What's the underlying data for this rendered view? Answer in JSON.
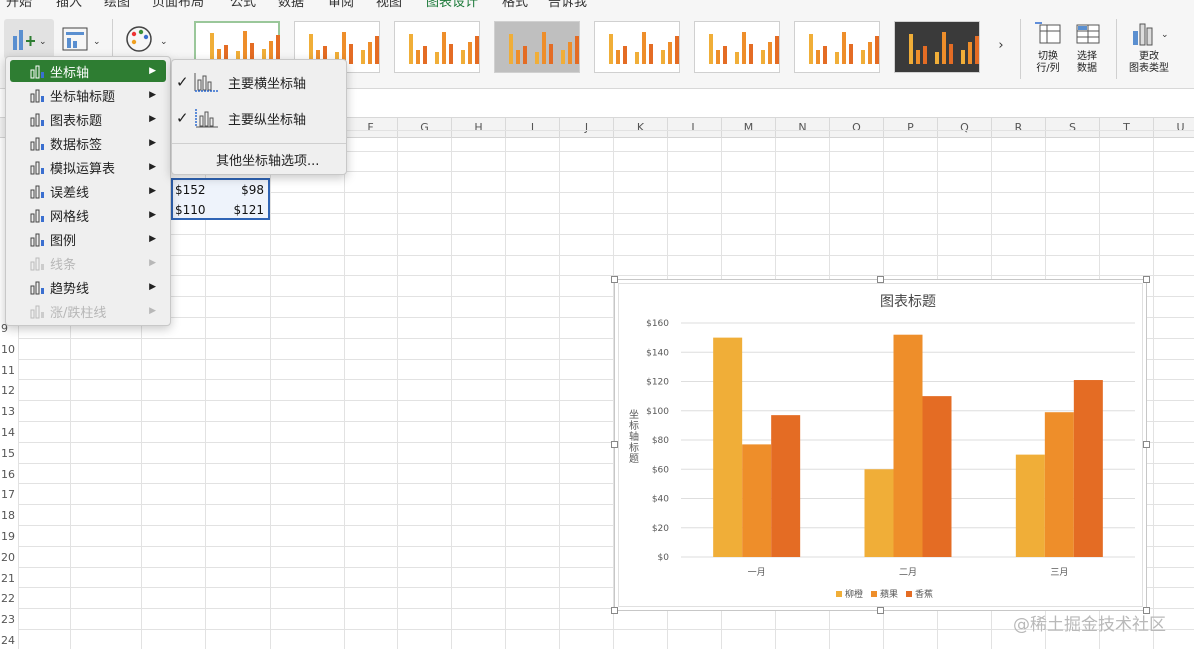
{
  "ribbon": {
    "tabs": [
      "开始",
      "插入",
      "绘图",
      "页面布局",
      "公式",
      "数据",
      "审阅",
      "视图",
      "图表设计",
      "格式",
      "告诉我"
    ],
    "active_tab": "图表设计",
    "switch_row_col": [
      "切换",
      "行/列"
    ],
    "select_data": [
      "选择",
      "数据"
    ],
    "change_chart_type": [
      "更改",
      "图表类型"
    ],
    "more_styles_icon": "chevron-right-icon",
    "accent": "#1d7a3a"
  },
  "columns": [
    "F",
    "G",
    "H",
    "I",
    "J",
    "K",
    "L",
    "M",
    "N",
    "O",
    "P",
    "Q",
    "R",
    "S",
    "T",
    "U"
  ],
  "rows": [
    "9",
    "10",
    "11",
    "12",
    "13",
    "14",
    "15",
    "16",
    "17",
    "18",
    "19",
    "20",
    "21",
    "22",
    "23",
    "24"
  ],
  "cells": {
    "r1": [
      "$152",
      "$98"
    ],
    "r2": [
      "$110",
      "$121"
    ]
  },
  "add_element_menu": {
    "items": [
      {
        "label": "坐标轴",
        "icon": "axis-icon",
        "highlighted": true,
        "disabled": false
      },
      {
        "label": "坐标轴标题",
        "icon": "axis-title-icon",
        "highlighted": false,
        "disabled": false
      },
      {
        "label": "图表标题",
        "icon": "chart-title-icon",
        "highlighted": false,
        "disabled": false
      },
      {
        "label": "数据标签",
        "icon": "data-label-icon",
        "highlighted": false,
        "disabled": false
      },
      {
        "label": "模拟运算表",
        "icon": "data-table-icon",
        "highlighted": false,
        "disabled": false
      },
      {
        "label": "误差线",
        "icon": "error-bar-icon",
        "highlighted": false,
        "disabled": false
      },
      {
        "label": "网格线",
        "icon": "gridlines-icon",
        "highlighted": false,
        "disabled": false
      },
      {
        "label": "图例",
        "icon": "legend-icon",
        "highlighted": false,
        "disabled": false
      },
      {
        "label": "线条",
        "icon": "lines-icon",
        "highlighted": false,
        "disabled": true
      },
      {
        "label": "趋势线",
        "icon": "trendline-icon",
        "highlighted": false,
        "disabled": false
      },
      {
        "label": "涨/跌柱线",
        "icon": "up-down-bars-icon",
        "highlighted": false,
        "disabled": true
      }
    ]
  },
  "axis_submenu": {
    "primary_horizontal": "主要横坐标轴",
    "primary_vertical": "主要纵坐标轴",
    "more_options": "其他坐标轴选项..."
  },
  "chart_data": {
    "type": "bar",
    "title": "图表标题",
    "xlabel": "",
    "ylabel": "坐标轴标题",
    "categories": [
      "一月",
      "二月",
      "三月"
    ],
    "series": [
      {
        "name": "柳橙",
        "values": [
          150,
          60,
          70
        ],
        "color": "#F0AE38"
      },
      {
        "name": "蘋果",
        "values": [
          77,
          152,
          99
        ],
        "color": "#EE8E2A"
      },
      {
        "name": "香蕉",
        "values": [
          97,
          110,
          121
        ],
        "color": "#E46C24"
      }
    ],
    "ylim": [
      0,
      160
    ],
    "yticks": [
      "$0",
      "$20",
      "$40",
      "$60",
      "$80",
      "$100",
      "$120",
      "$140",
      "$160"
    ],
    "grid": true,
    "legend": "bottom"
  },
  "watermark": "@稀土掘金技术社区"
}
